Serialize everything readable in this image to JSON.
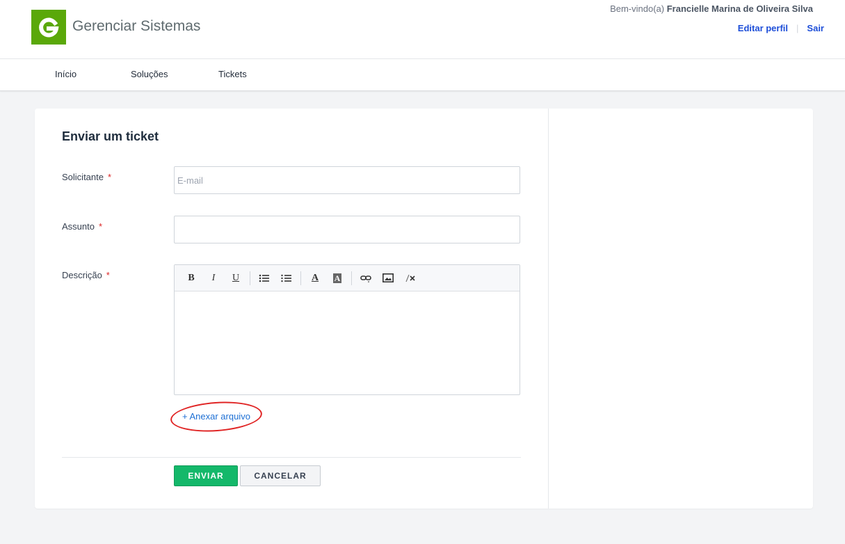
{
  "header": {
    "logo_letter": "G",
    "app_title": "Gerenciar Sistemas",
    "welcome_prefix": "Bem-vindo(a) ",
    "user_name": "Francielle Marina de Oliveira Silva",
    "edit_profile": "Editar perfil",
    "separator": "|",
    "logout": "Sair"
  },
  "nav": {
    "items": [
      {
        "label": "Início"
      },
      {
        "label": "Soluções"
      },
      {
        "label": "Tickets"
      }
    ]
  },
  "form": {
    "title": "Enviar um ticket",
    "required_mark": "*",
    "requester": {
      "label": "Solicitante",
      "placeholder": "E-mail",
      "value": ""
    },
    "subject": {
      "label": "Assunto",
      "value": ""
    },
    "description": {
      "label": "Descrição",
      "value": ""
    },
    "toolbar": {
      "bold": "B",
      "italic": "I",
      "underline": "U",
      "bulleted_list": "bulleted-list-icon",
      "numbered_list": "numbered-list-icon",
      "text_color": "A",
      "highlight": "A",
      "link": "link-icon",
      "image": "image-icon",
      "clear_format": "clear-format-icon"
    },
    "attach_link": "+ Anexar arquivo",
    "submit_label": "ENVIAR",
    "cancel_label": "CANCELAR"
  },
  "colors": {
    "brand_green": "#5aa80a",
    "link_blue": "#1d4ed8",
    "submit_green": "#14b86a",
    "required_red": "#dc2626",
    "annotation_red": "#e02424"
  }
}
